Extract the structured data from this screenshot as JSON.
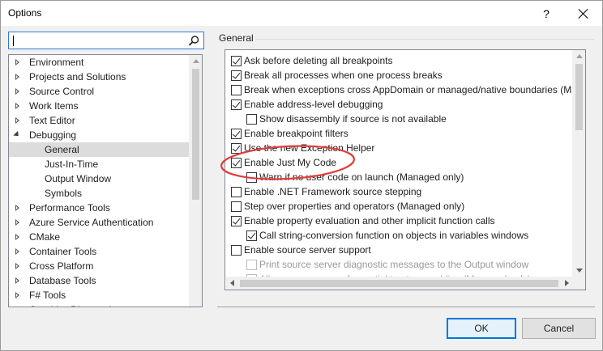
{
  "window": {
    "title": "Options",
    "help_label": "?"
  },
  "search": {
    "value": "",
    "placeholder": ""
  },
  "tree": {
    "items": [
      {
        "label": "Environment",
        "state": "collapsed",
        "level": 0
      },
      {
        "label": "Projects and Solutions",
        "state": "collapsed",
        "level": 0
      },
      {
        "label": "Source Control",
        "state": "collapsed",
        "level": 0
      },
      {
        "label": "Work Items",
        "state": "collapsed",
        "level": 0
      },
      {
        "label": "Text Editor",
        "state": "collapsed",
        "level": 0
      },
      {
        "label": "Debugging",
        "state": "expanded",
        "level": 0
      },
      {
        "label": "General",
        "state": "selected",
        "level": 1
      },
      {
        "label": "Just-In-Time",
        "state": "leaf",
        "level": 1
      },
      {
        "label": "Output Window",
        "state": "leaf",
        "level": 1
      },
      {
        "label": "Symbols",
        "state": "leaf",
        "level": 1
      },
      {
        "label": "Performance Tools",
        "state": "collapsed",
        "level": 0
      },
      {
        "label": "Azure Service Authentication",
        "state": "collapsed",
        "level": 0
      },
      {
        "label": "CMake",
        "state": "collapsed",
        "level": 0
      },
      {
        "label": "Container Tools",
        "state": "collapsed",
        "level": 0
      },
      {
        "label": "Cross Platform",
        "state": "collapsed",
        "level": 0
      },
      {
        "label": "Database Tools",
        "state": "collapsed",
        "level": 0
      },
      {
        "label": "F# Tools",
        "state": "collapsed",
        "level": 0
      },
      {
        "label": "Graphics Diagnostics",
        "state": "collapsed",
        "level": 0
      }
    ]
  },
  "panel": {
    "title": "General",
    "options": [
      {
        "label": "Ask before deleting all breakpoints",
        "checked": true,
        "enabled": true,
        "indent": 0
      },
      {
        "label": "Break all processes when one process breaks",
        "checked": true,
        "enabled": true,
        "indent": 0
      },
      {
        "label": "Break when exceptions cross AppDomain or managed/native boundaries (Ma",
        "checked": false,
        "enabled": true,
        "indent": 0
      },
      {
        "label": "Enable address-level debugging",
        "checked": true,
        "enabled": true,
        "indent": 0
      },
      {
        "label": "Show disassembly if source is not available",
        "checked": false,
        "enabled": true,
        "indent": 1
      },
      {
        "label": "Enable breakpoint filters",
        "checked": true,
        "enabled": true,
        "indent": 0
      },
      {
        "label": "Use the new Exception Helper",
        "checked": true,
        "enabled": true,
        "indent": 0
      },
      {
        "label": "Enable Just My Code",
        "checked": true,
        "enabled": true,
        "indent": 0
      },
      {
        "label": "Warn if no user code on launch (Managed only)",
        "checked": false,
        "enabled": true,
        "indent": 1
      },
      {
        "label": "Enable .NET Framework source stepping",
        "checked": false,
        "enabled": true,
        "indent": 0
      },
      {
        "label": "Step over properties and operators (Managed only)",
        "checked": false,
        "enabled": true,
        "indent": 0
      },
      {
        "label": "Enable property evaluation and other implicit function calls",
        "checked": true,
        "enabled": true,
        "indent": 0
      },
      {
        "label": "Call string-conversion function on objects in variables windows",
        "checked": true,
        "enabled": true,
        "indent": 1
      },
      {
        "label": "Enable source server support",
        "checked": false,
        "enabled": true,
        "indent": 0
      },
      {
        "label": "Print source server diagnostic messages to the Output window",
        "checked": false,
        "enabled": false,
        "indent": 1
      },
      {
        "label": "Allow source server for partial trust assemblies (Managed only)",
        "checked": false,
        "enabled": false,
        "indent": 1
      }
    ]
  },
  "buttons": {
    "ok": "OK",
    "cancel": "Cancel"
  },
  "colors": {
    "accent": "#0078d7",
    "highlight": "#e03c3c",
    "selection": "#dcdcdc"
  }
}
